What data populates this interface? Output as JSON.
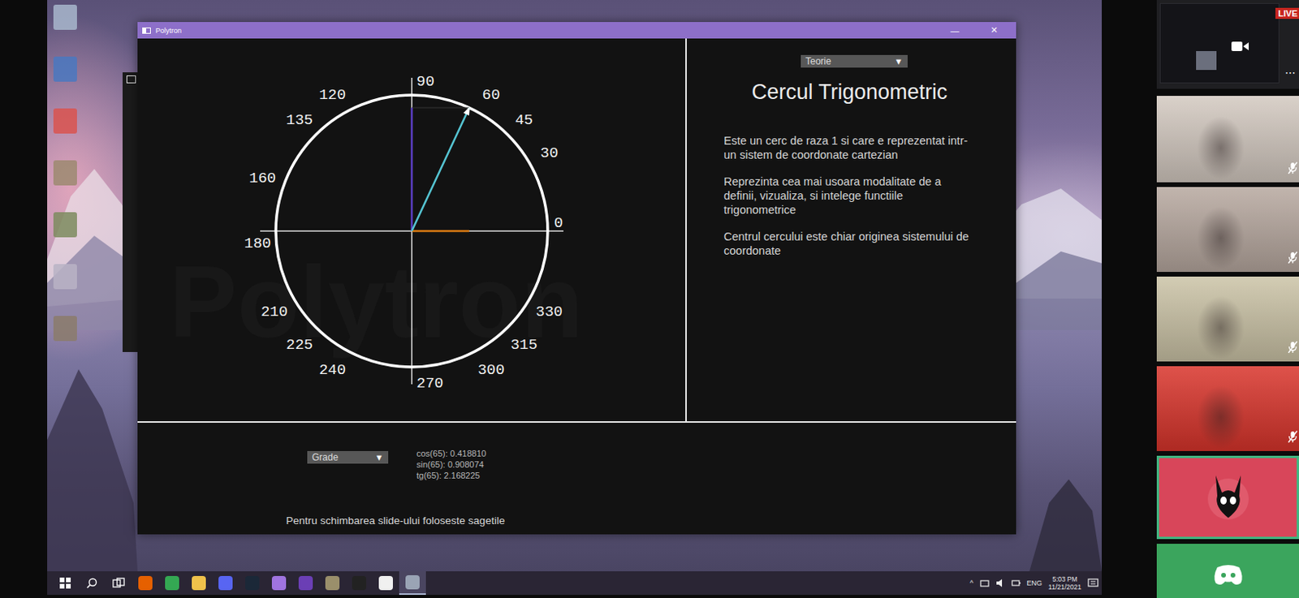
{
  "window": {
    "title": "Polytron",
    "minimize": "—",
    "close": "✕"
  },
  "diagram": {
    "watermark": "Polytron",
    "angle": 65,
    "labels": [
      "90",
      "60",
      "45",
      "30",
      "0",
      "330",
      "315",
      "300",
      "270",
      "240",
      "225",
      "210",
      "180",
      "160",
      "135",
      "120"
    ]
  },
  "theory": {
    "dropdown": "Teorie",
    "arrow": "▼",
    "title": "Cercul Trigonometric",
    "paragraphs": [
      "Este un cerc de raza 1 si care e reprezentat intr-un sistem de coordonate cartezian",
      "Reprezinta cea mai usoara modalitate de a definii, vizualiza, si intelege functiile trigonometrice",
      "Centrul cercului este chiar originea sistemului de coordonate"
    ]
  },
  "bottom": {
    "dropdown": "Grade",
    "arrow": "▼",
    "values": [
      "cos(65): 0.418810",
      "sin(65): 0.908074",
      "tg(65): 2.168225"
    ],
    "hint": "Pentru schimbarea slide-ului foloseste sagetile"
  },
  "taskbar": {
    "apps": [
      {
        "color": "#e66000",
        "selected": false
      },
      {
        "color": "#34a853",
        "selected": false
      },
      {
        "color": "#f0c24b",
        "selected": false
      },
      {
        "color": "#5865f2",
        "selected": false
      },
      {
        "color": "#1b2838",
        "selected": false
      },
      {
        "color": "#a074e0",
        "selected": false
      },
      {
        "color": "#6b3fb5",
        "selected": false
      },
      {
        "color": "#9a8f6b",
        "selected": false
      },
      {
        "color": "#222222",
        "selected": false
      },
      {
        "color": "#f0f0f0",
        "selected": false
      },
      {
        "color": "#9aa4b5",
        "selected": true
      }
    ],
    "chevron": "^",
    "language": "ENG",
    "time": "5:03 PM",
    "date": "11/21/2021"
  },
  "call": {
    "live": "LIVE",
    "more": "⋯",
    "participants": [
      {
        "kind": "video",
        "color": "#d3c9c0",
        "muted": true,
        "speaking": false
      },
      {
        "kind": "video",
        "color": "#b7a89f",
        "muted": true,
        "speaking": false
      },
      {
        "kind": "video",
        "color": "#cbc3a6",
        "muted": true,
        "speaking": false
      },
      {
        "kind": "video",
        "color": "#d9342b",
        "muted": true,
        "speaking": false
      },
      {
        "kind": "avatar",
        "color": "#d8465a",
        "muted": false,
        "speaking": true
      },
      {
        "kind": "app",
        "color": "#3ba55d",
        "muted": false,
        "speaking": false
      }
    ]
  }
}
